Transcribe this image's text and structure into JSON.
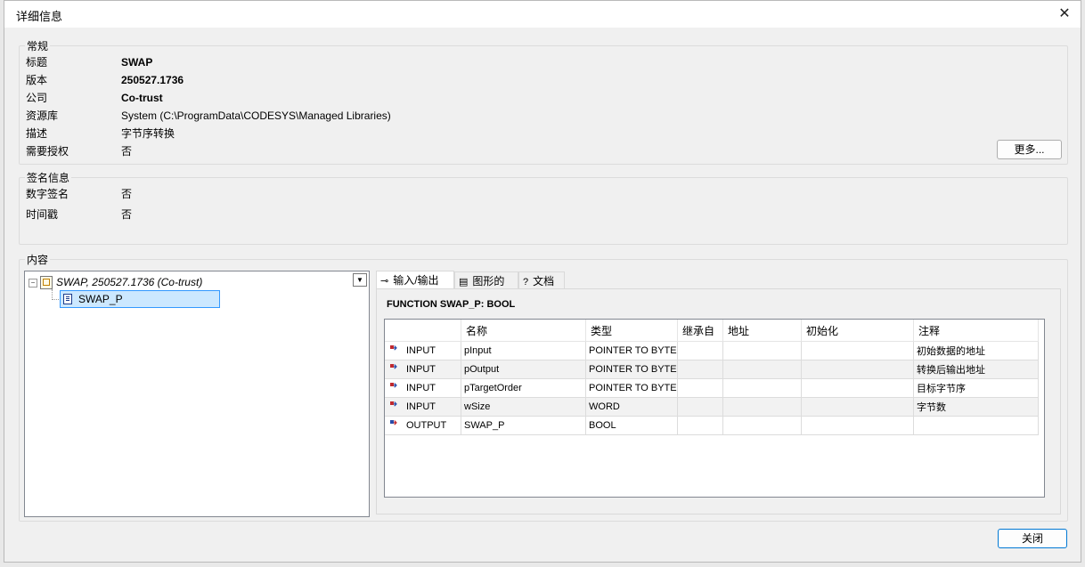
{
  "dialog": {
    "title": "详细信息",
    "close_icon": "close-icon"
  },
  "general": {
    "legend": "常规",
    "rows": [
      {
        "label": "标题",
        "value": "SWAP",
        "bold": true
      },
      {
        "label": "版本",
        "value": "250527.1736",
        "bold": true
      },
      {
        "label": "公司",
        "value": "Co-trust",
        "bold": true
      },
      {
        "label": "资源库",
        "value": "System (C:\\ProgramData\\CODESYS\\Managed Libraries)",
        "bold": false
      },
      {
        "label": "描述",
        "value": "字节序转换",
        "bold": false
      },
      {
        "label": "需要授权",
        "value": "否",
        "bold": false
      }
    ],
    "more_button": "更多..."
  },
  "signature": {
    "legend": "签名信息",
    "rows": [
      {
        "label": "数字签名",
        "value": "否"
      },
      {
        "label": "时间戳",
        "value": "否"
      }
    ]
  },
  "content": {
    "legend": "内容",
    "tree": {
      "root_label": "SWAP, 250527.1736 (Co-trust)",
      "child_label": "SWAP_P"
    },
    "tabs": [
      {
        "label": "输入/输出",
        "icon": "io-connector-icon"
      },
      {
        "label": "图形的",
        "icon": "graphic-icon"
      },
      {
        "label": "文档",
        "icon": "help-doc-icon"
      }
    ],
    "function_header": "FUNCTION  SWAP_P: BOOL",
    "table": {
      "columns": [
        "",
        "名称",
        "类型",
        "继承自",
        "地址",
        "初始化",
        "注释"
      ],
      "rows": [
        {
          "dir": "INPUT",
          "name": "pInput",
          "type": "POINTER TO BYTE",
          "inherited": "",
          "address": "",
          "init": "",
          "comment": "初始数据的地址"
        },
        {
          "dir": "INPUT",
          "name": "pOutput",
          "type": "POINTER TO BYTE",
          "inherited": "",
          "address": "",
          "init": "",
          "comment": "转换后输出地址"
        },
        {
          "dir": "INPUT",
          "name": "pTargetOrder",
          "type": "POINTER TO BYTE",
          "inherited": "",
          "address": "",
          "init": "",
          "comment": "目标字节序"
        },
        {
          "dir": "INPUT",
          "name": "wSize",
          "type": "WORD",
          "inherited": "",
          "address": "",
          "init": "",
          "comment": "字节数"
        },
        {
          "dir": "OUTPUT",
          "name": "SWAP_P",
          "type": "BOOL",
          "inherited": "",
          "address": "",
          "init": "",
          "comment": ""
        }
      ]
    }
  },
  "footer": {
    "close_button": "关闭"
  }
}
